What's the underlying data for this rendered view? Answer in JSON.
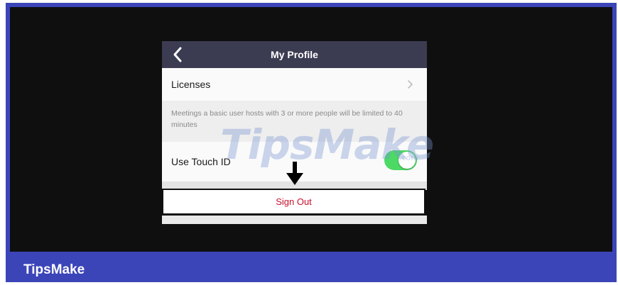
{
  "colors": {
    "frame": "#3b45b8",
    "background": "#0f0f10",
    "nav_bar": "#3b3b52",
    "toggle_on": "#4cd964",
    "sign_out_text": "#c8102e"
  },
  "nav": {
    "back_icon": "chevron-left-icon",
    "title": "My Profile"
  },
  "licenses": {
    "label": "Licenses",
    "icon": "chevron-right-icon",
    "note": "Meetings a basic user hosts with 3 or more people will be limited to 40 minutes"
  },
  "touch_id": {
    "label": "Use Touch ID",
    "enabled": true
  },
  "sign_out": {
    "label": "Sign Out"
  },
  "annotation": {
    "icon": "down-arrow-icon"
  },
  "watermark": {
    "text": "TipsMake",
    "suffix": ".com"
  },
  "brand": {
    "name": "TipsMake"
  }
}
